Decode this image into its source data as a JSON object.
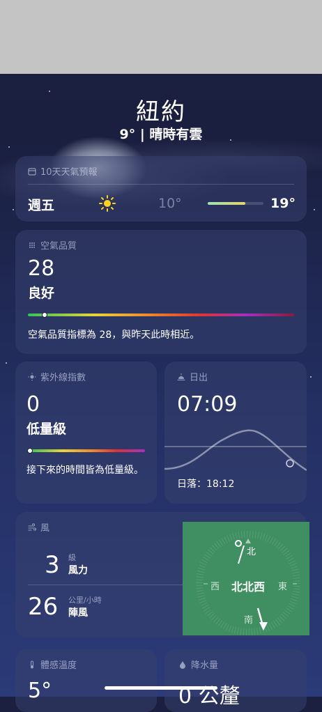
{
  "city": "紐約",
  "current": "9° | 晴時有雲",
  "forecast": {
    "label": "10天天氣預報",
    "day": "週五",
    "icon": "sun-icon",
    "low": "10°",
    "high": "19°"
  },
  "air": {
    "label": "空氣品質",
    "value": "28",
    "level": "良好",
    "desc": "空氣品質指標為 28，與昨天此時相近。"
  },
  "uv": {
    "label": "紫外線指數",
    "value": "0",
    "level": "低量級",
    "desc": "接下來的時間皆為低量級。"
  },
  "sunrise": {
    "label": "日出",
    "time": "07:09",
    "sunset": "日落：18:12"
  },
  "wind": {
    "label": "風",
    "force_value": "3",
    "force_unit": "級",
    "force_label": "風力",
    "gust_value": "26",
    "gust_unit": "公里/小時",
    "gust_label": "陣風",
    "direction": "北北西",
    "compass": {
      "n": "北",
      "s": "南",
      "e": "東",
      "w": "西"
    }
  },
  "feels": {
    "label": "體感溫度",
    "value": "5°"
  },
  "precip": {
    "label": "降水量",
    "value": "0 公釐"
  },
  "colors": {
    "wind_highlight": "#3f8f62",
    "top_bar": "#c4c4c4"
  }
}
